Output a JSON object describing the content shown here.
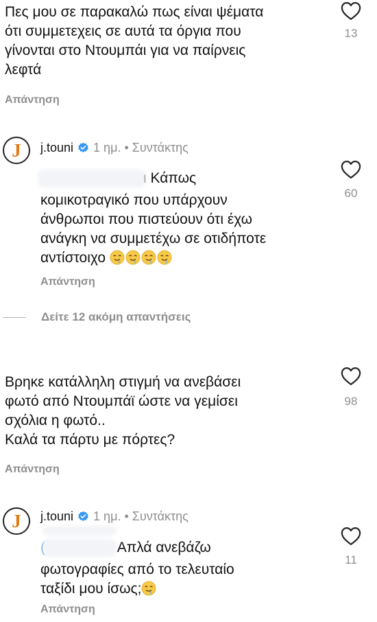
{
  "comments": [
    {
      "text": "Πες μου σε παρακαλώ πως είναι ψέματα\nότι συμμετεχεις σε αυτά τα όργια που\nγίνονται στο Ντουμπάι για να παίρνεις\nλεφτά",
      "reply_label": "Απάντηση",
      "likes": "13"
    },
    {
      "username": "j.touni",
      "meta": "1 ημ. • Συντάκτης",
      "mention_tail": "ι",
      "text_first": "Κάπως",
      "text": "κομικοτραγικό που υπάρχουν\nάνθρωποι που πιστεύουν ότι έχω\nανάγκη να συμμετέχω σε οτιδήποτε\nαντίστοιχο",
      "reply_label": "Απάντηση",
      "likes": "60"
    },
    {
      "text": "Βρηκε κατάλληλη στιγμή να ανεβάσει\nφωτό από Ντουμπάϊ ώστε να γεμίσει\nσχόλια η φωτό..\nΚαλά τα πάρτυ με πόρτες?",
      "reply_label": "Απάντηση",
      "likes": "98"
    },
    {
      "username": "j.touni",
      "meta": "1 ημ. • Συντάκτης",
      "mention_head": "(",
      "text_first": "Απλά ανεβάζω",
      "text": "φωτογραφίες από το τελευταίο\nταξίδι μου ίσως;",
      "reply_label": "Απάντηση",
      "likes": "11"
    }
  ],
  "view_more": "Δείτε 12 ακόμη απαντήσεις",
  "avatar_letter": "J",
  "icons": {
    "like": "heart-outline-icon",
    "verified": "verified-badge-icon",
    "emoji": "drooling-face-emoji"
  },
  "colors": {
    "verified": "#3897f0",
    "muted": "#8e8e8e",
    "avatar_letter": "#e07b1a"
  }
}
